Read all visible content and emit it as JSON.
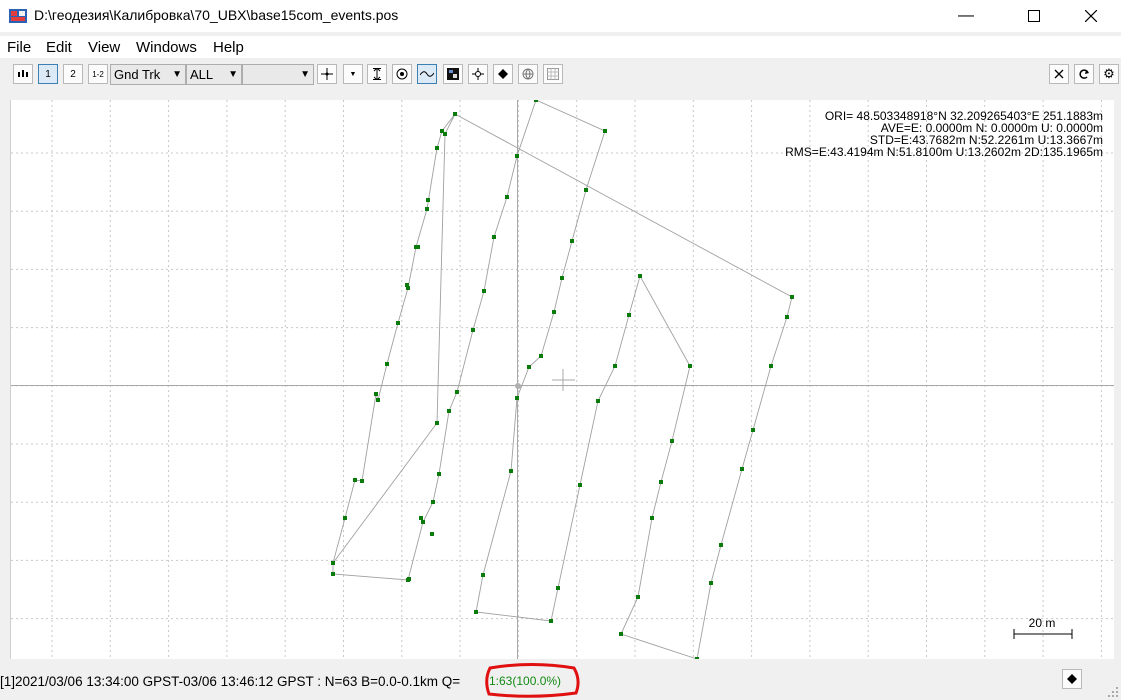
{
  "window": {
    "title": "D:\\геодезия\\Калибровка\\70_UBX\\base15com_events.pos",
    "minimize_icon": "minimize-icon",
    "maximize_icon": "maximize-icon",
    "close_icon": "close-icon"
  },
  "menu": [
    "File",
    "Edit",
    "View",
    "Windows",
    "Help"
  ],
  "toolbar": {
    "plot_type": "Gnd Trk",
    "quality": "ALL",
    "satellite": "",
    "btn_1": "1",
    "btn_2": "2",
    "btn_12": "1-2"
  },
  "info": {
    "ori": "ORI= 48.503348918°N   32.209265403°E 251.1883m",
    "ave": "AVE=E: 0.0000m N: 0.0000m U: 0.0000m",
    "std": "STD=E:43.7682m N:52.2261m U:13.3667m",
    "rms": "RMS=E:43.4194m N:51.8100m U:13.2602m 2D:135.1965m"
  },
  "scale_label": "20 m",
  "status": {
    "text": "[1]2021/03/06 13:34:00 GPST-03/06 13:46:12 GPST : N=63 B=0.0-0.1km Q=",
    "q_value": "1:63(100.0%)"
  },
  "colors": {
    "point": "#0a7a0a",
    "track_line": "#a0a0a0",
    "grid": "#c8c8c8",
    "q_text": "#138a13",
    "highlight": "#e01010"
  }
}
